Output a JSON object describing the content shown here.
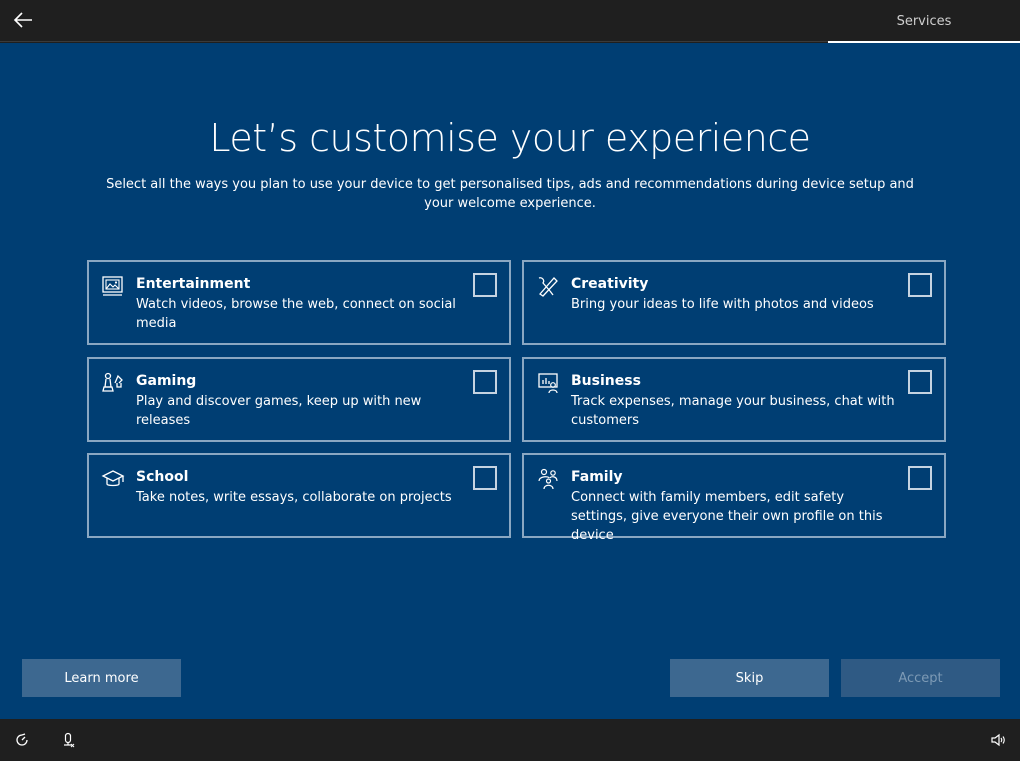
{
  "topbar": {
    "back_icon": "back-arrow-icon",
    "tab_label": "Services"
  },
  "main": {
    "title": "Let’s customise your experience",
    "subtitle": "Select all the ways you plan to use your device to get personalised tips, ads and recommendations during device setup and your welcome experience."
  },
  "cards": [
    {
      "title": "Entertainment",
      "description": "Watch videos, browse the web, connect on social media",
      "icon": "picture-icon",
      "checked": false
    },
    {
      "title": "Creativity",
      "description": "Bring your ideas to life with photos and videos",
      "icon": "brush-pen-icon",
      "checked": false
    },
    {
      "title": "Gaming",
      "description": "Play and discover games, keep up with new releases",
      "icon": "game-pieces-icon",
      "checked": false
    },
    {
      "title": "Business",
      "description": "Track expenses, manage your business, chat with customers",
      "icon": "presentation-chart-icon",
      "checked": false
    },
    {
      "title": "School",
      "description": "Take notes, write essays, collaborate on projects",
      "icon": "graduation-cap-icon",
      "checked": false
    },
    {
      "title": "Family",
      "description": "Connect with family members, edit safety settings, give everyone their own profile on this device",
      "icon": "family-people-icon",
      "checked": false
    }
  ],
  "buttons": {
    "learn_more": "Learn more",
    "skip": "Skip",
    "accept": "Accept"
  },
  "bottombar": {
    "icons": [
      "ease-of-access-icon",
      "microphone-icon",
      "volume-icon"
    ]
  },
  "colors": {
    "background": "#003e73",
    "bar": "#1f1f1f",
    "button": "#3d6890",
    "card_border": "#8aa7c2"
  }
}
